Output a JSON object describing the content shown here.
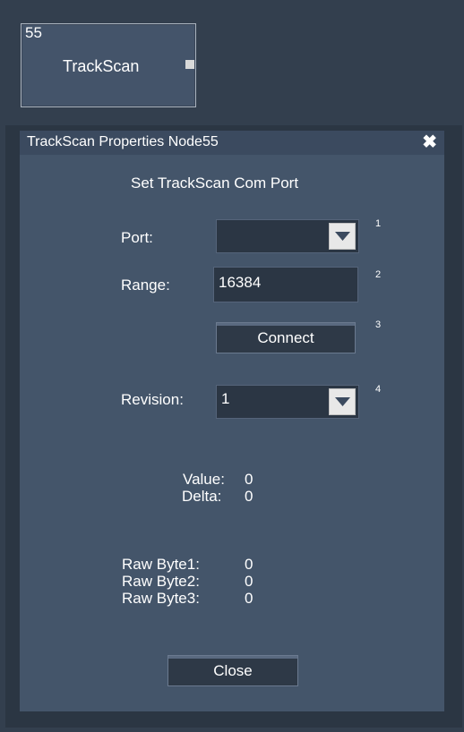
{
  "node": {
    "id": "55",
    "name": "TrackScan"
  },
  "dialog": {
    "title": "TrackScan Properties Node55",
    "close_glyph": "✖",
    "heading": "Set TrackScan Com Port",
    "port": {
      "label": "Port:",
      "value": "",
      "step": "1"
    },
    "range": {
      "label": "Range:",
      "value": "16384",
      "step": "2"
    },
    "connect": {
      "label": "Connect",
      "step": "3"
    },
    "revision": {
      "label": "Revision:",
      "value": "1",
      "step": "4"
    },
    "value": {
      "label": "Value:",
      "value": "0"
    },
    "delta": {
      "label": "Delta:",
      "value": "0"
    },
    "raw": [
      {
        "label": "Raw Byte1:",
        "value": "0"
      },
      {
        "label": "Raw Byte2:",
        "value": "0"
      },
      {
        "label": "Raw Byte3:",
        "value": "0"
      }
    ],
    "close_button": "Close"
  }
}
